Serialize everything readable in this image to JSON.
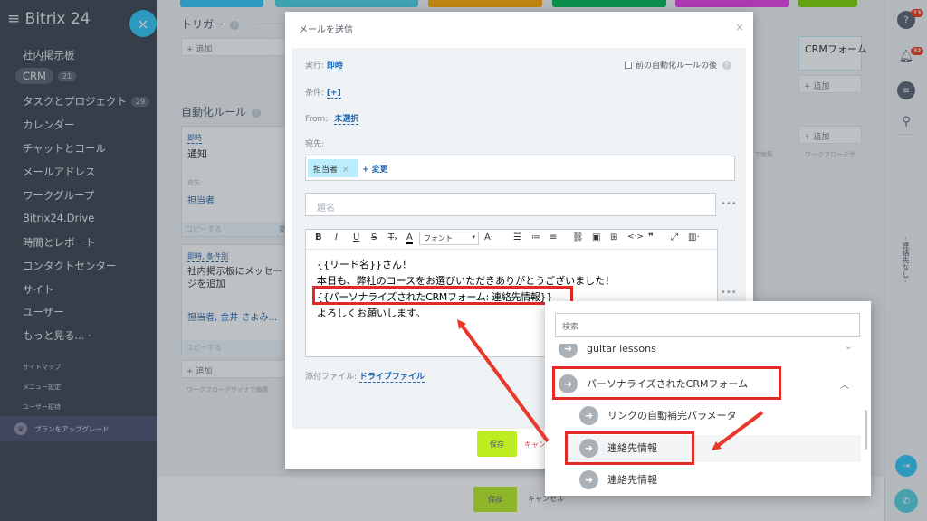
{
  "sidebar": {
    "logo": "Bitrix 24",
    "collapse_icon": "×",
    "items": [
      {
        "label": "社内掲示板"
      },
      {
        "label": "CRM",
        "badge": "21"
      },
      {
        "label": "タスクとプロジェクト",
        "badge": "29"
      },
      {
        "label": "カレンダー"
      },
      {
        "label": "チャットとコール"
      },
      {
        "label": "メールアドレス"
      },
      {
        "label": "ワークグループ"
      },
      {
        "label": "Bitrix24.Drive"
      },
      {
        "label": "時間とレポート"
      },
      {
        "label": "コンタクトセンター"
      },
      {
        "label": "サイト"
      },
      {
        "label": "ユーザー"
      },
      {
        "label": "もっと見る... ·"
      }
    ],
    "small_items": [
      "サイトマップ",
      "メニュー設定",
      "ユーザー招待"
    ],
    "upgrade": "プランをアップグレード"
  },
  "main": {
    "triggers_heading": "トリガー",
    "rules_heading": "自動化ルール",
    "add_label": "+ 追加",
    "crm_form_cell": "CRMフォーム",
    "card1": {
      "when": "即時",
      "title": "通知",
      "to_label": "宛先:",
      "to_value": "担当者",
      "copy": "コピーする",
      "edit": "変"
    },
    "card2": {
      "when": "即時, 条件別",
      "title": "社内掲示板にメッセージを追加",
      "to_label": "宛先:",
      "to_value": "担当者, 金井 さよみ...",
      "copy": "コピーする"
    },
    "designer_link": "ワークフローデザイナで編集",
    "bg_edit": "で編集",
    "bg_designer": "ワークフローデザ"
  },
  "footer": {
    "save": "保存",
    "cancel": "キャンセル"
  },
  "rightbar": {
    "help_badge": "13",
    "bell_badge": "32",
    "contacts_label": "- 連絡先なし -"
  },
  "modal": {
    "title": "メールを送信",
    "close": "×",
    "exec_label": "実行:",
    "exec_value": "即時",
    "prev_rule_label": "前の自動化ルールの後",
    "condition_label": "条件:",
    "condition_value": "[+]",
    "from_label": "From:",
    "from_value": "未選択",
    "to_label": "宛先:",
    "to_tag": "担当者",
    "to_change": "+ 変更",
    "subject_placeholder": "題名",
    "toolbar": {
      "font": "フォント",
      "size": "A"
    },
    "body_lines": [
      "{{リード名}}さん！",
      "本日も、弊社のコースをお選びいただきありがとうございました！",
      "{{パーソナライズされたCRMフォーム: 連絡先情報}}",
      "よろしくお願いします。"
    ],
    "attach_label": "添付ファイル:",
    "attach_value": "ドライブファイル",
    "save": "保存",
    "cancel": "キャン"
  },
  "popup": {
    "search_placeholder": "検索",
    "items": [
      {
        "label": "guitar lessons"
      },
      {
        "label": "パーソナライズされたCRMフォーム"
      },
      {
        "label": "リンクの自動補完パラメータ"
      },
      {
        "label": "連絡先情報"
      },
      {
        "label": "連絡先情報"
      }
    ]
  },
  "colors": {
    "accent_red": "#e02b27",
    "link_blue": "#2067b0",
    "save_green": "#bbed21",
    "stages": [
      "#2fc6f6",
      "#47d1e2",
      "#ffa900",
      "#00b853",
      "#ff5752",
      "#e53ee7",
      "#7bd500"
    ]
  }
}
